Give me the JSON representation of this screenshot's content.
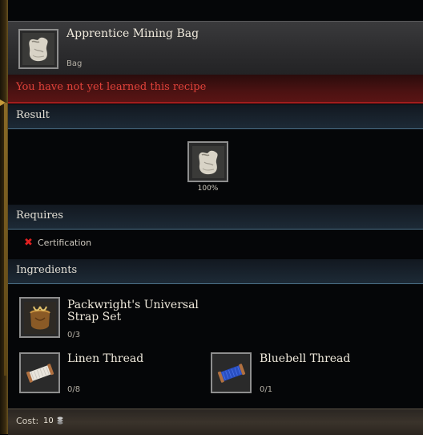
{
  "header": {
    "title": "Apprentice Mining Bag",
    "subtitle": "Bag",
    "icon": "bag-icon"
  },
  "warning": {
    "text": "You have not yet learned this recipe",
    "color": "#e0423a"
  },
  "sections": {
    "result": "Result",
    "requires": "Requires",
    "ingredients": "Ingredients"
  },
  "result": {
    "icon": "bag-icon",
    "chance": "100%"
  },
  "requires": [
    {
      "status_icon": "cross-icon",
      "label": "Certification",
      "met": false
    }
  ],
  "ingredients": [
    {
      "name": "Packwright's Universal Strap Set",
      "count": "0/3",
      "icon": "strap-set-icon"
    },
    {
      "name": "Linen Thread",
      "count": "0/8",
      "icon": "linen-thread-icon"
    },
    {
      "name": "Bluebell Thread",
      "count": "0/1",
      "icon": "bluebell-thread-icon"
    }
  ],
  "footer": {
    "cost_label": "Cost:",
    "cost_value": "10",
    "currency_icon": "silver-coin-icon"
  }
}
